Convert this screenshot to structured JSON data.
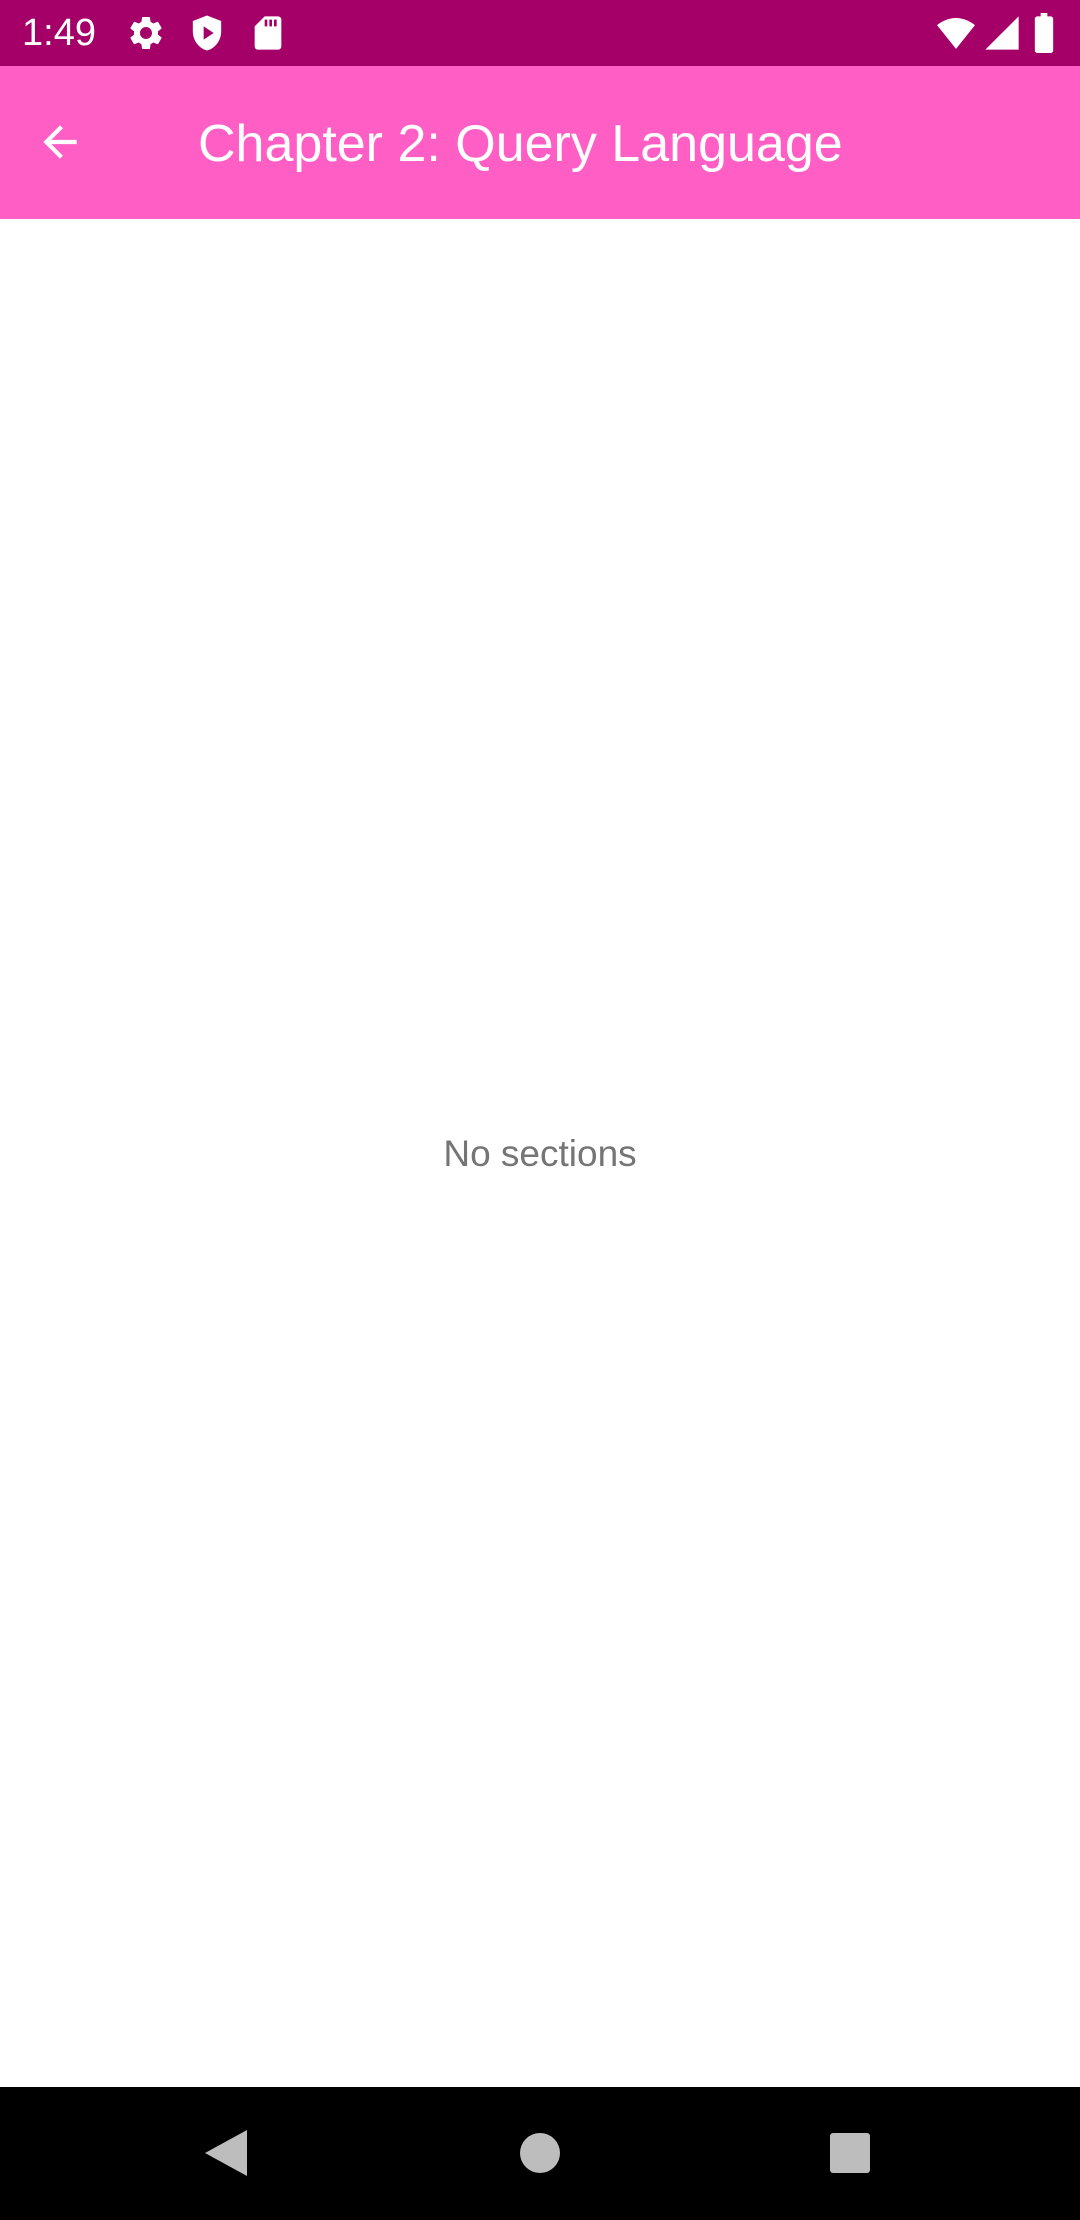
{
  "status_bar": {
    "time": "1:49",
    "background": "#a50068",
    "left_icons": [
      "settings-icon",
      "shield-play-icon",
      "sd-card-icon"
    ],
    "right_icons": [
      "wifi-icon",
      "cellular-signal-icon",
      "battery-icon"
    ]
  },
  "app_bar": {
    "title": "Chapter 2: Query Language",
    "background": "#ff5fc4",
    "back_icon": "arrow-back-icon"
  },
  "content": {
    "empty_message": "No sections"
  },
  "nav_bar": {
    "buttons": [
      "back-triangle-icon",
      "home-circle-icon",
      "recents-square-icon"
    ]
  }
}
